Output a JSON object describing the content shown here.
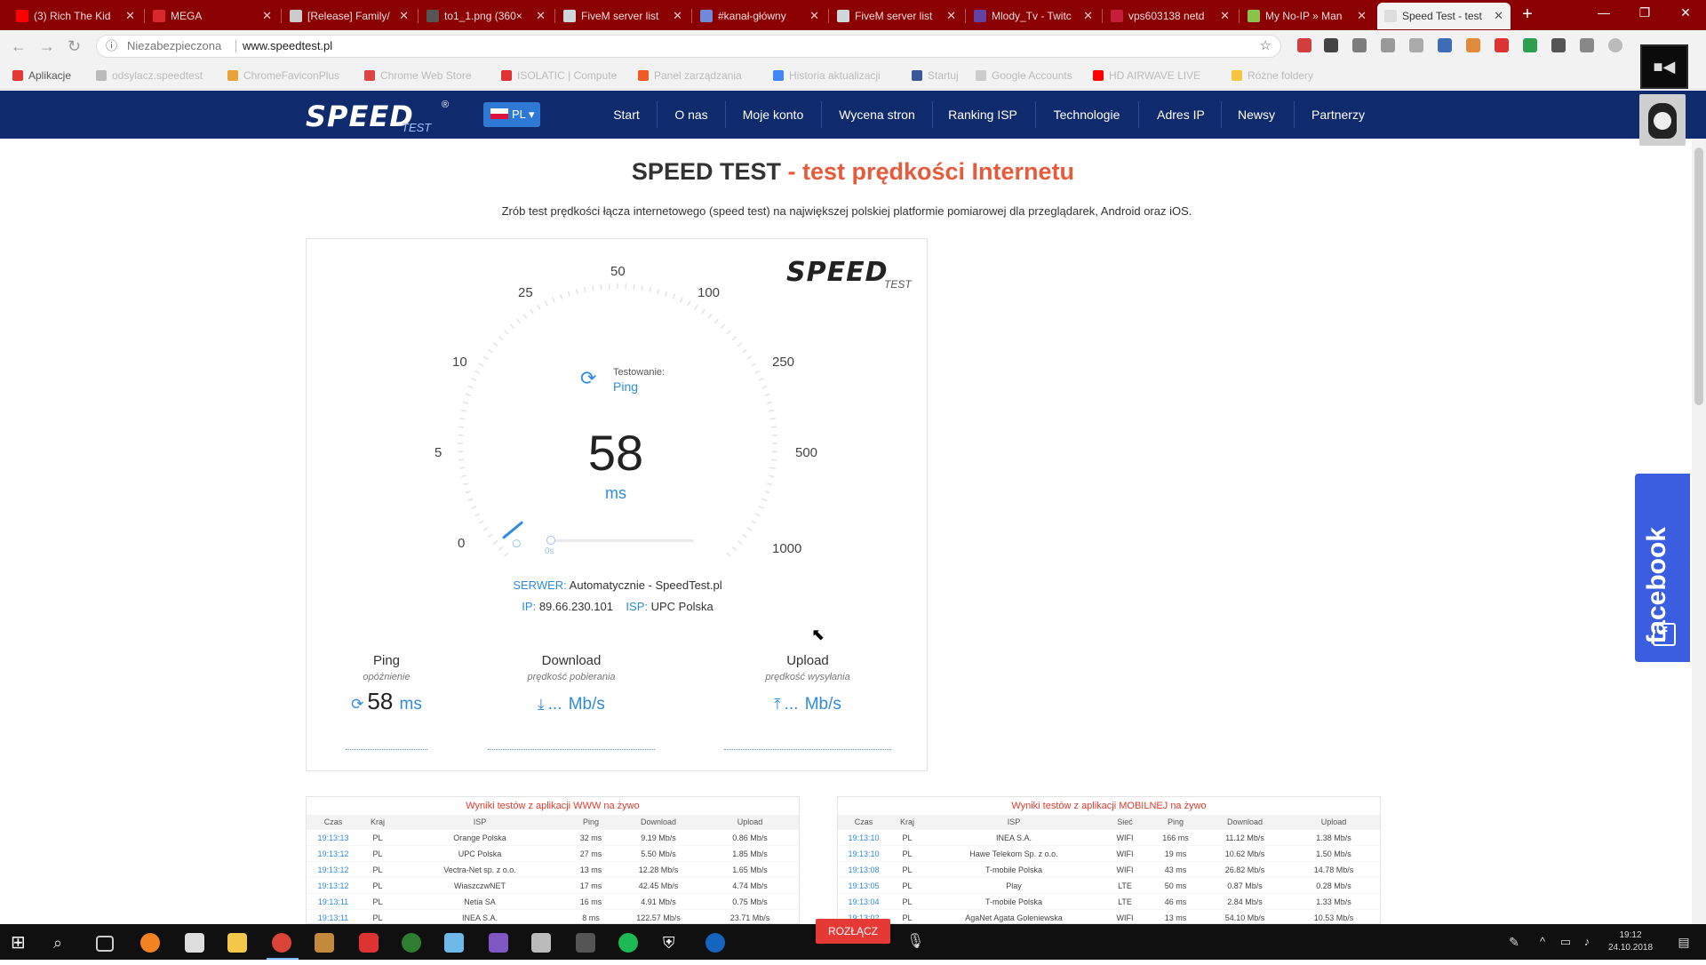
{
  "browser": {
    "tabs": [
      {
        "title": "(3) Rich The Kid",
        "color": "#ff0000"
      },
      {
        "title": "MEGA",
        "color": "#d9272e"
      },
      {
        "title": "[Release] Family/",
        "color": "#cccccc"
      },
      {
        "title": "to1_1.png (360×",
        "color": "#555555"
      },
      {
        "title": "FiveM server list",
        "color": "#cfd8dc"
      },
      {
        "title": "#kanał-główny",
        "color": "#7289da"
      },
      {
        "title": "FiveM server list",
        "color": "#cfd8dc"
      },
      {
        "title": "Mlody_Tv - Twitc",
        "color": "#6441a5"
      },
      {
        "title": "vps603138 netd",
        "color": "#c41e3a"
      },
      {
        "title": "My No-IP » Man",
        "color": "#8bc34a"
      },
      {
        "title": "Speed Test - test",
        "color": "#dddddd"
      }
    ],
    "window_controls": {
      "minimize": "—",
      "restore": "❐",
      "close": "✕"
    },
    "address": {
      "security": "Niezabezpieczona",
      "url": "www.speedtest.pl"
    },
    "bookmarks": [
      {
        "label": "Aplikacje",
        "faint": false
      },
      {
        "label": "odsylacz.speedtest",
        "faint": true
      },
      {
        "label": "ChromeFaviconPlus",
        "faint": true
      },
      {
        "label": "Chrome Web Store",
        "faint": true
      },
      {
        "label": "ISOLATIC | Compute",
        "faint": true
      },
      {
        "label": "Panel zarządzania",
        "faint": true
      },
      {
        "label": "Historia aktualizacji",
        "faint": true
      },
      {
        "label": "Startuj",
        "faint": true
      },
      {
        "label": "Google Accounts",
        "faint": true
      },
      {
        "label": "HD AIRWAVE LIVE",
        "faint": true
      },
      {
        "label": "Różne foldery",
        "faint": true
      }
    ]
  },
  "site": {
    "logo": {
      "main": "SPEED",
      "sub": "TEST",
      "mark": "®"
    },
    "lang": "PL",
    "nav": [
      "Start",
      "O nas",
      "Moje konto",
      "Wycena stron",
      "Ranking ISP",
      "Technologie",
      "Adres IP",
      "Newsy",
      "Partnerzy"
    ],
    "title_main": "SPEED TEST",
    "title_accent": "- test prędkości Internetu",
    "subtitle": "Zrób test prędkości łącza internetowego (speed test) na największej polskiej platformie pomiarowej dla przeglądarek, Android oraz iOS."
  },
  "gauge": {
    "ticks": [
      "0",
      "5",
      "10",
      "25",
      "50",
      "100",
      "250",
      "500",
      "1000"
    ],
    "testing_label": "Testowanie:",
    "testing_value": "Ping",
    "value": "58",
    "unit": "ms",
    "slider_zero": "0s",
    "needle_fraction": 0.02
  },
  "server": {
    "server_label": "SERWER:",
    "server_value": "Automatycznie - SpeedTest.pl",
    "ip_label": "IP:",
    "ip_value": "89.66.230.101",
    "isp_label": "ISP:",
    "isp_value": "UPC Polska"
  },
  "stats": {
    "ping": {
      "label": "Ping",
      "sub": "opóźnienie",
      "value": "58",
      "unit": "ms"
    },
    "download": {
      "label": "Download",
      "sub": "prędkość pobierania",
      "value": "...",
      "unit": "Mb/s"
    },
    "upload": {
      "label": "Upload",
      "sub": "prędkość wysyłania",
      "value": "...",
      "unit": "Mb/s"
    }
  },
  "live_www": {
    "title": "Wyniki testów z aplikacji WWW na żywo",
    "columns": [
      "Czas",
      "Kraj",
      "ISP",
      "Ping",
      "Download",
      "Upload"
    ],
    "rows": [
      [
        "19:13:13",
        "PL",
        "Orange Polska",
        "32 ms",
        "9.19 Mb/s",
        "0.86 Mb/s"
      ],
      [
        "19:13:12",
        "PL",
        "UPC Polska",
        "27 ms",
        "5.50 Mb/s",
        "1.85 Mb/s"
      ],
      [
        "19:13:12",
        "PL",
        "Vectra-Net sp. z o.o.",
        "13 ms",
        "12.28 Mb/s",
        "1.65 Mb/s"
      ],
      [
        "19:13:12",
        "PL",
        "WiaszczwNET",
        "17 ms",
        "42.45 Mb/s",
        "4.74 Mb/s"
      ],
      [
        "19:13:11",
        "PL",
        "Netia SA",
        "16 ms",
        "4.91 Mb/s",
        "0.75 Mb/s"
      ],
      [
        "19:13:11",
        "PL",
        "INEA S.A.",
        "8 ms",
        "122.57 Mb/s",
        "23.71 Mb/s"
      ]
    ]
  },
  "live_mobile": {
    "title": "Wyniki testów z aplikacji MOBILNEJ na żywo",
    "columns": [
      "Czas",
      "Kraj",
      "ISP",
      "Sieć",
      "Ping",
      "Download",
      "Upload"
    ],
    "rows": [
      [
        "19:13:10",
        "PL",
        "INEA S.A.",
        "WIFI",
        "166 ms",
        "11.12 Mb/s",
        "1.38 Mb/s"
      ],
      [
        "19:13:10",
        "PL",
        "Hawe Telekom Sp. z o.o.",
        "WIFI",
        "19 ms",
        "10.62 Mb/s",
        "1.50 Mb/s"
      ],
      [
        "19:13:08",
        "PL",
        "T-mobile Polska",
        "WIFI",
        "43 ms",
        "26.82 Mb/s",
        "14.78 Mb/s"
      ],
      [
        "19:13:05",
        "PL",
        "Play",
        "LTE",
        "50 ms",
        "0.87 Mb/s",
        "0.28 Mb/s"
      ],
      [
        "19:13:04",
        "PL",
        "T-mobile Polska",
        "LTE",
        "46 ms",
        "2.84 Mb/s",
        "1.33 Mb/s"
      ],
      [
        "19:13:02",
        "PL",
        "AgaNet Agata Goleniewska",
        "WIFI",
        "13 ms",
        "54.10 Mb/s",
        "10.53 Mb/s"
      ]
    ]
  },
  "facebook_tab": "facebook",
  "taskbar": {
    "disconnect": "ROZŁĄCZ",
    "time": "19:12",
    "date": "24.10.2018"
  }
}
